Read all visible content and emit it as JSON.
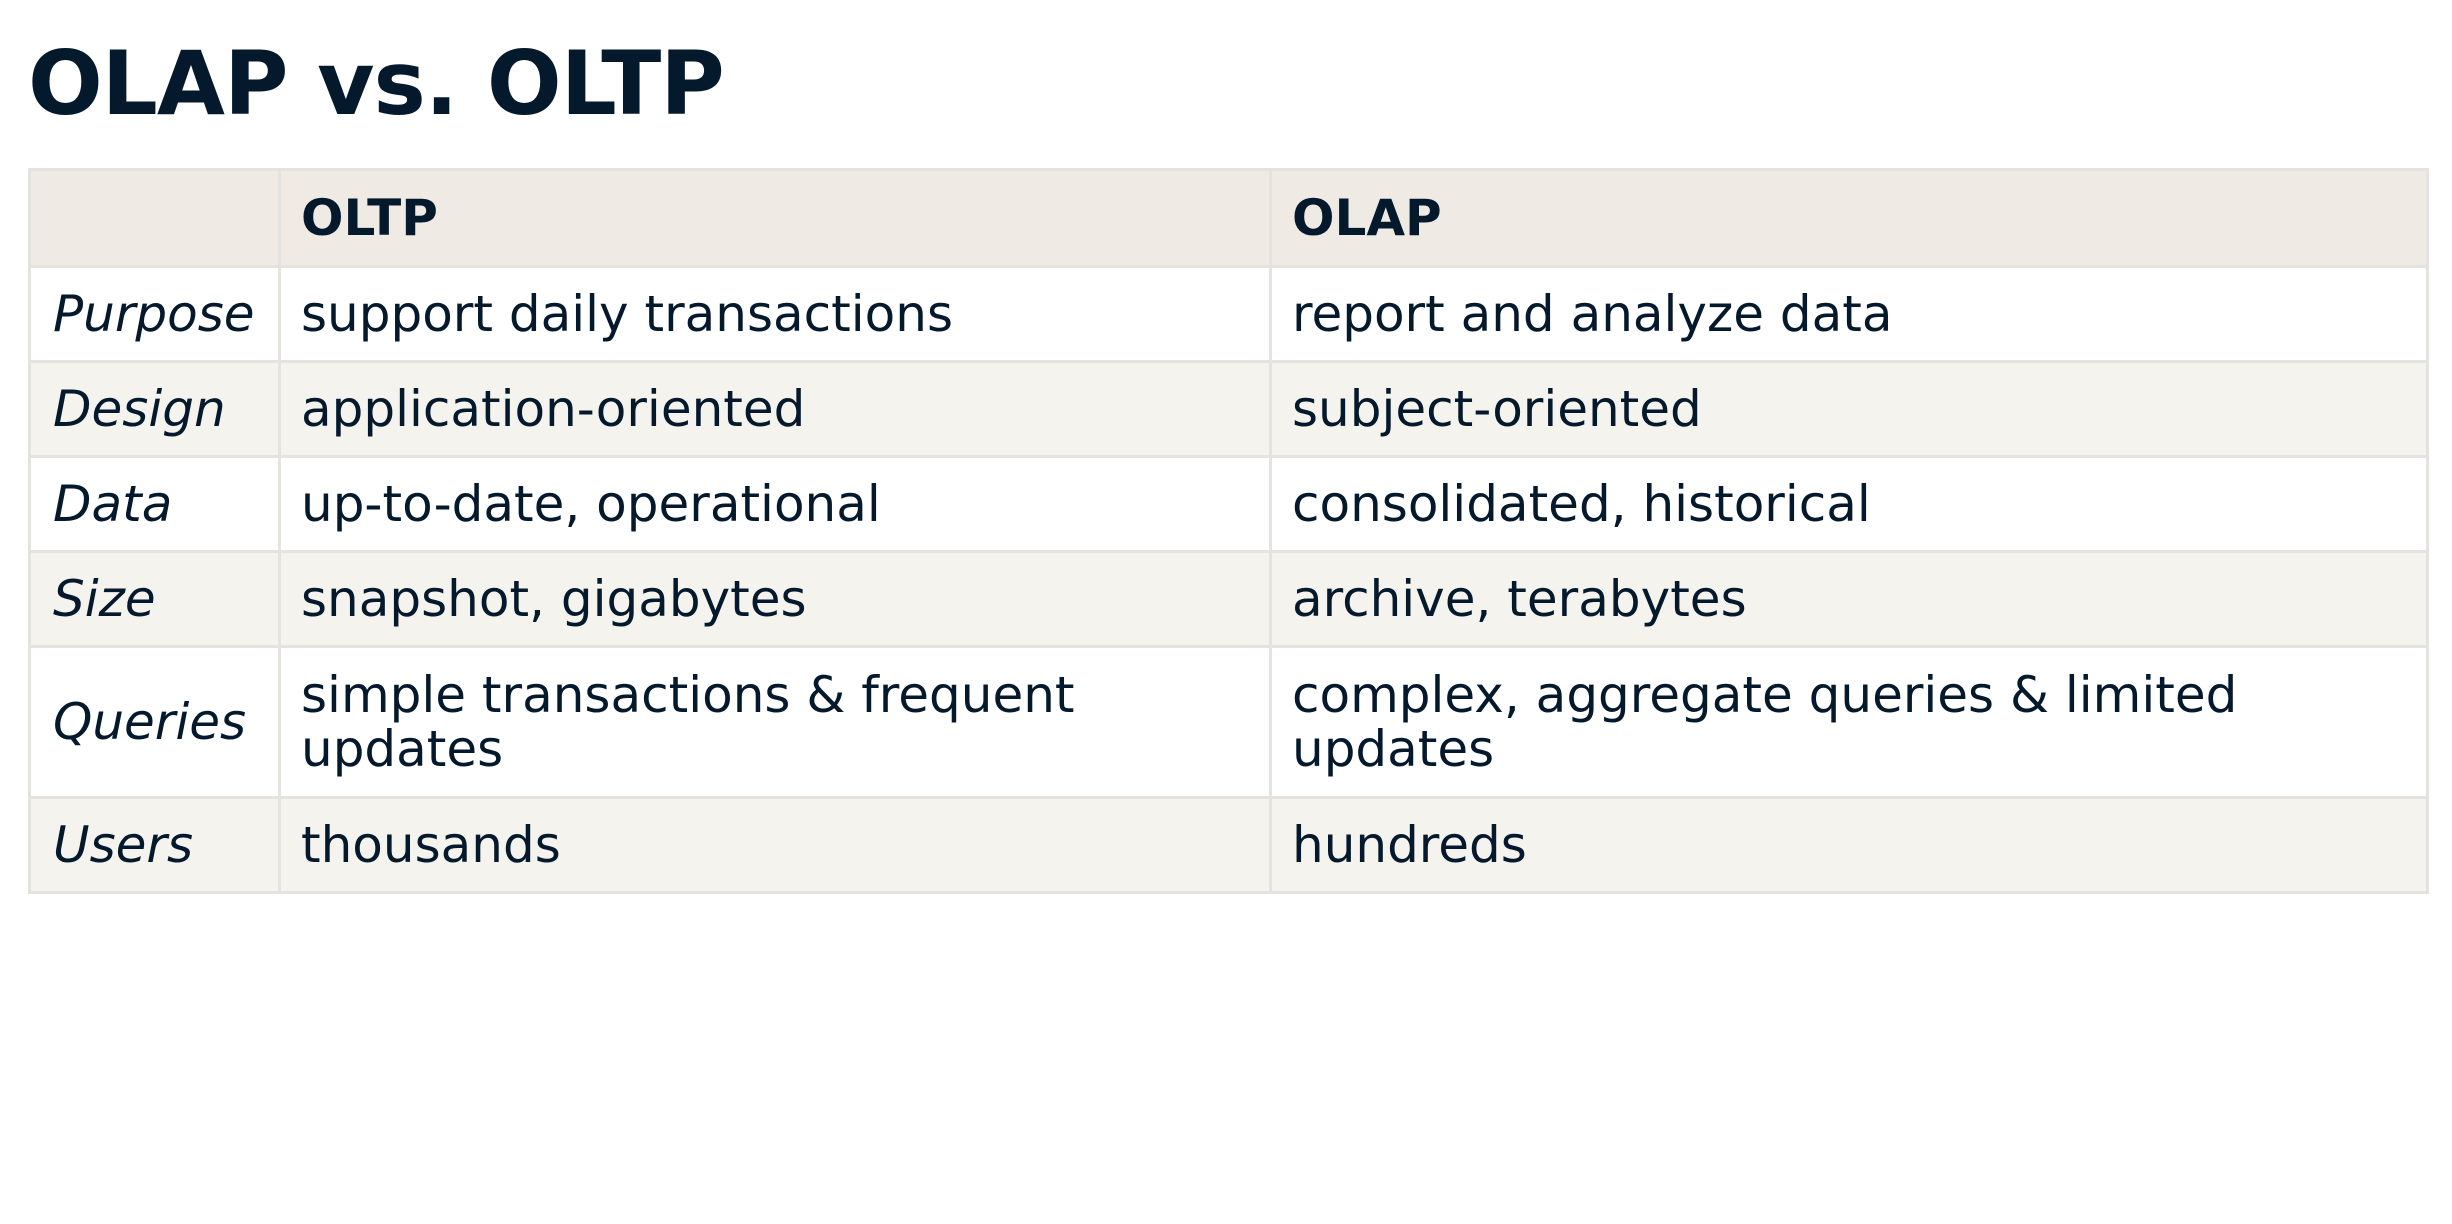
{
  "title": "OLAP vs. OLTP",
  "table": {
    "headers": [
      "",
      "OLTP",
      "OLAP"
    ],
    "rows": [
      {
        "label": "Purpose",
        "oltp": "support daily transactions",
        "olap": "report and analyze data"
      },
      {
        "label": "Design",
        "oltp": "application-oriented",
        "olap": "subject-oriented"
      },
      {
        "label": "Data",
        "oltp": "up-to-date, operational",
        "olap": "consolidated, historical"
      },
      {
        "label": "Size",
        "oltp": "snapshot, gigabytes",
        "olap": "archive, terabytes"
      },
      {
        "label": "Queries",
        "oltp": "simple transactions & frequent updates",
        "olap": "complex, aggregate queries & limited updates"
      },
      {
        "label": "Users",
        "oltp": "thousands",
        "olap": "hundreds"
      }
    ]
  },
  "colors": {
    "text": "#05192d",
    "header_background": "#efebe4",
    "alt_row_background": "#f5f3ee",
    "border": "#e5e3df"
  }
}
